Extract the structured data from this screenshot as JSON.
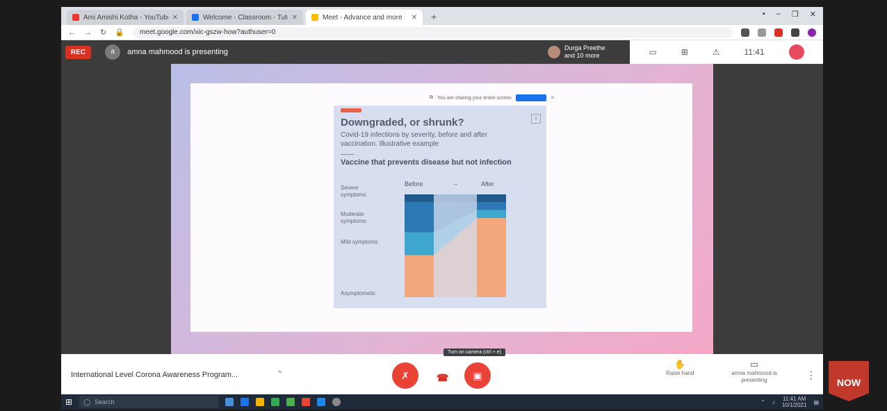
{
  "browser": {
    "tabs": [
      {
        "title": "Ami Amishi Kotha - YouTube Music",
        "color": "#e53935",
        "active": false
      },
      {
        "title": "Welcome - Classroom - Tutorials",
        "color": "#1a73e8",
        "active": false
      },
      {
        "title": "Meet - Advance and more",
        "color": "#fbbc04",
        "active": true
      }
    ],
    "url": "meet.google.com/xic-gszw-how?authuser=0",
    "new_tab": "+",
    "window_controls": [
      "•",
      "–",
      "❐",
      "✕"
    ],
    "extensions": [
      "#555",
      "#999",
      "#d93025",
      "#444",
      "#8e24aa"
    ]
  },
  "meet": {
    "rec_label": "REC",
    "presenter_initial": "a",
    "presenting_text": "amna mahmood is presenting",
    "participants_line1": "Durga Preethe",
    "participants_line2": "and 10 more",
    "time": "11:41",
    "meeting_name": "International Level Corona Awareness Program...",
    "tooltip": "Turn on camera (ctrl + e)",
    "raise_hand": "Raise hand",
    "presenting_btn": "amna mahmood is presenting",
    "more": "⋮"
  },
  "slide": {
    "toast_text": "You are sharing your entire screen",
    "card_title": "Downgraded, or shrunk?",
    "card_subtitle": "Covid-19 infections by severity, before and after vaccination. Illustrative example",
    "card_heading": "Vaccine that prevents disease but not infection",
    "col_before": "Before",
    "col_after": "After",
    "arrow": "→",
    "categories": [
      "Severe symptoms",
      "Moderate symptoms",
      "Mild symptoms",
      "Asymptomatic"
    ],
    "colors": {
      "severe": "#1f5a8a",
      "moderate": "#2b78b5",
      "mild": "#3ea6cf",
      "asym": "#f2a77c"
    }
  },
  "chart_data": {
    "type": "bar",
    "title": "Downgraded, or shrunk?",
    "categories": [
      "Before",
      "After"
    ],
    "series": [
      {
        "name": "Severe symptoms",
        "values": [
          10,
          10
        ]
      },
      {
        "name": "Moderate symptoms",
        "values": [
          40,
          10
        ]
      },
      {
        "name": "Mild symptoms",
        "values": [
          30,
          10
        ]
      },
      {
        "name": "Asymptomatic",
        "values": [
          55,
          100
        ]
      }
    ]
  },
  "taskbar": {
    "search_placeholder": "Search",
    "icons": [
      "#4a90d9",
      "#1a73e8",
      "#f4b400",
      "#34a853",
      "#4caf50",
      "#ea4335",
      "#1e88e5",
      "#888"
    ],
    "tray_time": "11:41 AM",
    "tray_date": "10/1/2021"
  },
  "badge": {
    "text": "NOW"
  }
}
